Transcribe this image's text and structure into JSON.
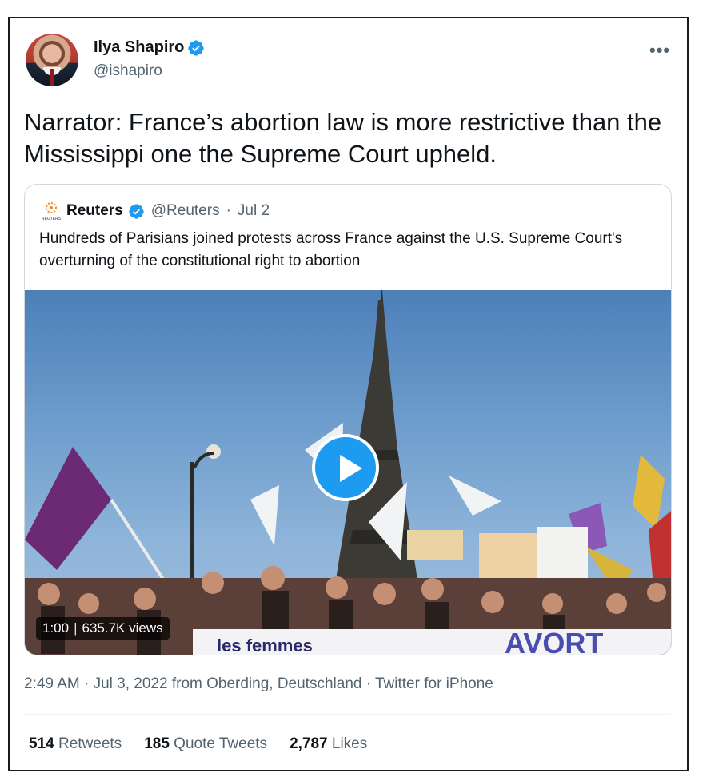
{
  "author": {
    "name": "Ilya Shapiro",
    "handle": "@ishapiro",
    "verified": true,
    "avatar_icon": "avatar-photo"
  },
  "more_icon": "more-horizontal-icon",
  "tweet": {
    "text": "Narrator: France’s abortion law is more restrictive than the Mississippi one the Supreme Court upheld."
  },
  "quote": {
    "logo_label": "REUTERS",
    "name": "Reuters",
    "handle": "@Reuters",
    "date": "Jul 2",
    "separator": "·",
    "text": "Hundreds of Parisians joined protests across France against the U.S. Supreme Court's overturning of the constitutional right to abortion",
    "video": {
      "duration": "1:00",
      "views": "635.7K views",
      "banner_text_left": "les femmes",
      "banner_text_right": "AVORT"
    }
  },
  "meta": {
    "timestamp": "2:49 AM · Jul 3, 2022 from Oberding, Deutschland · Twitter for iPhone"
  },
  "stats": [
    {
      "count": "514",
      "label": "Retweets"
    },
    {
      "count": "185",
      "label": "Quote Tweets"
    },
    {
      "count": "2,787",
      "label": "Likes"
    }
  ],
  "colors": {
    "accent": "#1d9bf0",
    "secondary_text": "#536471",
    "border": "#cfd9de"
  }
}
